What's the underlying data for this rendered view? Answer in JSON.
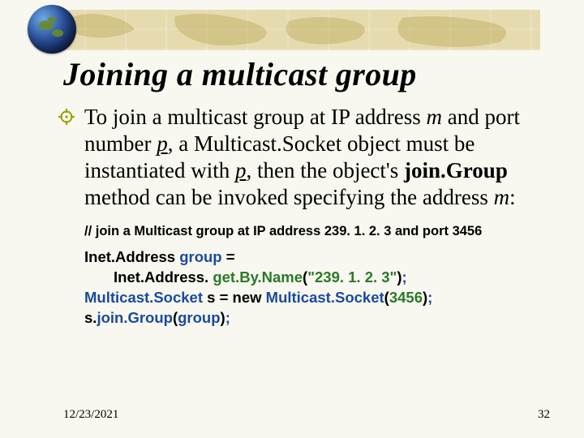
{
  "title": "Joining a multicast group",
  "bullet_html": "To join a multicast group at IP address <i class=\"mi\">m</i> and port number <u class=\"p\">p</u>, a Multicast.Socket object must be instantiated with <u class=\"p\">p</u>, then the object's <b>join.Group</b> method can be invoked specifying the address <i class=\"mi\">m</i>:",
  "comment": "// join a Multicast group at IP address 239. 1. 2. 3 and port 3456",
  "code_lines_html": [
    "<span class=\"cls\">Inet.Address</span> <span class=\"var\">group</span> <span class=\"pun\">=</span>",
    "<span class=\"indent\"></span><span class=\"cls\">Inet.Address.</span> <span class=\"mth\">get.By.Name</span><span class=\"pun\">(</span><span class=\"lit\">\"239. 1. 2. 3\"</span><span class=\"pun\">)</span><span class=\"semi\">;</span>",
    "<span class=\"var\">Multicast.Socket</span> <span class=\"cls\">s</span> <span class=\"pun\">= new</span> <span class=\"var\">Multicast.Socket</span><span class=\"pun\">(</span><span class=\"lit\">3456</span><span class=\"pun\">)</span><span class=\"semi\">;</span>",
    "<span class=\"cls\">s.</span><span class=\"var\">join.Group</span><span class=\"pun\">(</span><span class=\"var\">group</span><span class=\"pun\">)</span><span class=\"semi\">;</span>"
  ],
  "footer": {
    "date": "12/23/2021",
    "page": "32"
  }
}
